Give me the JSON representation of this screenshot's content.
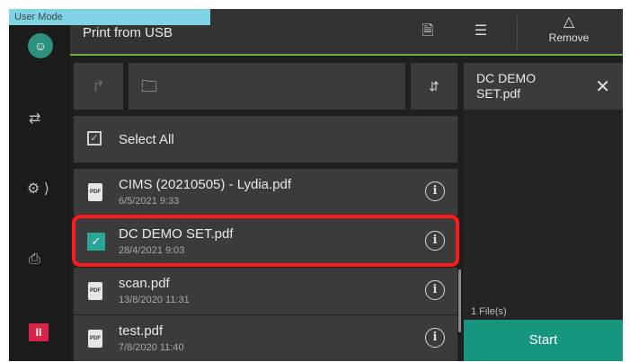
{
  "mode_tab": "User Mode",
  "header": {
    "title": "Print from USB",
    "remove_label": "Remove"
  },
  "icons": {
    "avatar": "user-icon",
    "swap": "swap-icon",
    "settings": "gear-icon",
    "printer_info": "printer-info-icon",
    "pause": "pause-icon",
    "document": "document-icon",
    "adjust": "sliders-icon",
    "eject": "eject-icon",
    "up": "up-arrow-icon",
    "folder": "folder-icon",
    "sort": "sort-icon",
    "info": "info-icon",
    "close": "close-icon"
  },
  "select_all_label": "Select All",
  "files": [
    {
      "name": "CIMS (20210505) - Lydia.pdf",
      "date": "6/5/2021 9:33",
      "selected": false
    },
    {
      "name": "DC DEMO SET.pdf",
      "date": "28/4/2021 9:03",
      "selected": true
    },
    {
      "name": "scan.pdf",
      "date": "13/8/2020 11:31",
      "selected": false
    },
    {
      "name": "test.pdf",
      "date": "7/8/2020 11:40",
      "selected": false
    }
  ],
  "right_panel": {
    "selected_name": "DC DEMO SET.pdf",
    "file_count": "1 File(s)",
    "start_label": "Start"
  },
  "colors": {
    "accent_teal": "#17967f",
    "highlight_red": "#ff1a1a",
    "header_underline": "#6fb33d",
    "mode_tab": "#7fd3e2",
    "pause_red": "#d8244b"
  }
}
